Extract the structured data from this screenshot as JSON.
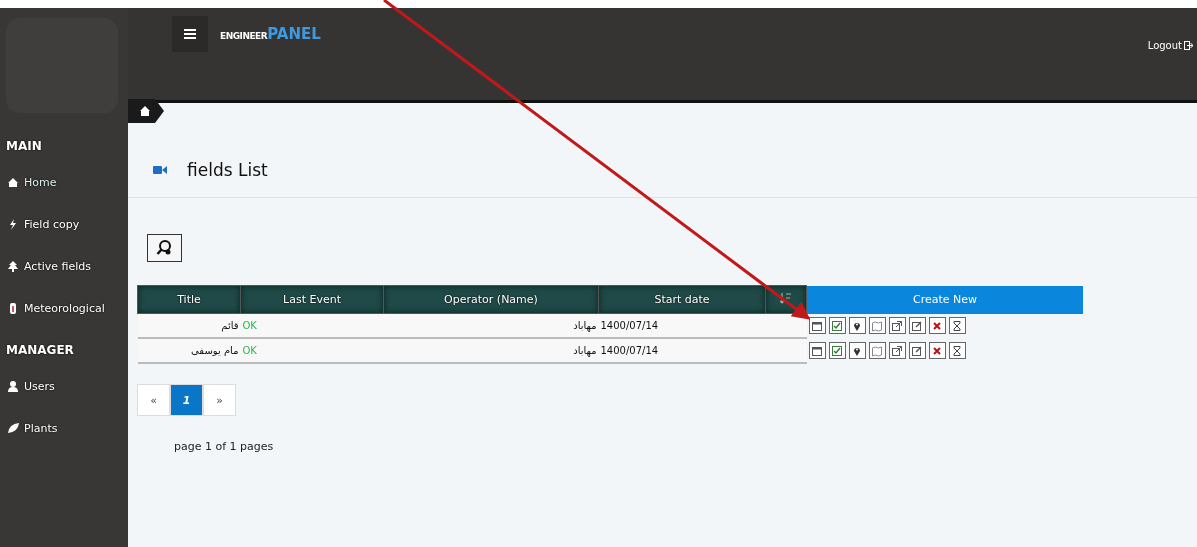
{
  "header": {
    "brand_part_1": "ENGINEER",
    "brand_part_2": "PANEL",
    "logout": "Logout"
  },
  "sidebar": {
    "sections": [
      {
        "title": "MAIN",
        "items": [
          {
            "label": "Home",
            "selected": true
          },
          {
            "label": "Field copy",
            "selected": false
          },
          {
            "label": "Active fields",
            "selected": false
          },
          {
            "label": "Meteorological",
            "selected": false
          }
        ]
      },
      {
        "title": "MANAGER",
        "items": [
          {
            "label": "Users",
            "selected": false
          },
          {
            "label": "Plants",
            "selected": false
          }
        ]
      }
    ]
  },
  "page": {
    "title": "fields List"
  },
  "table": {
    "columns": [
      "Title",
      "Last Event",
      "Operator (Name)",
      "Start date"
    ],
    "create_button": "Create New",
    "rows": [
      {
        "title": "قائم",
        "last_event": "OK",
        "operator": "مهاباد",
        "start_date": "1400/07/14"
      },
      {
        "title": "مام یوسفی",
        "last_event": "OK",
        "operator": "مهاباد",
        "start_date": "1400/07/14"
      }
    ]
  },
  "pagination": {
    "prev": "«",
    "pages": [
      {
        "label": "1",
        "selected": true
      }
    ],
    "next": "»",
    "summary": "page 1 of 1 pages"
  }
}
